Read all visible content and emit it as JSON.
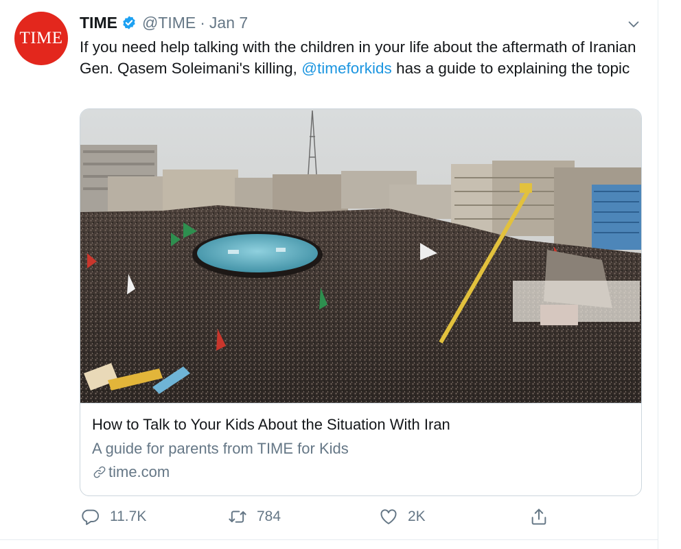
{
  "tweet": {
    "avatar_text": "TIME",
    "display_name": "TIME",
    "handle": "@TIME",
    "separator": "·",
    "date": "Jan 7",
    "text_before": "If you need help talking with the children in your life about the aftermath of Iranian Gen. Qasem Soleimani's killing, ",
    "mention": "@timeforkids",
    "text_after": " has a guide to explaining the topic"
  },
  "card": {
    "image_desc": "Aerial photo of a massive crowd filling a city square around a round fountain, with flags and buildings",
    "title": "How to Talk to Your Kids About the Situation With Iran",
    "description": "A guide for parents from TIME for Kids",
    "domain": "time.com"
  },
  "actions": {
    "reply_count": "11.7K",
    "retweet_count": "784",
    "like_count": "2K"
  },
  "icons": {
    "verified": "verified-badge-icon",
    "caret": "chevron-down-icon",
    "link": "link-icon",
    "reply": "reply-icon",
    "retweet": "retweet-icon",
    "like": "heart-icon",
    "share": "share-icon"
  },
  "colors": {
    "brand_red": "#e3271d",
    "link_blue": "#1b95e0",
    "muted": "#657786",
    "border": "#ccd6dd",
    "verified_blue": "#1da1f2"
  }
}
